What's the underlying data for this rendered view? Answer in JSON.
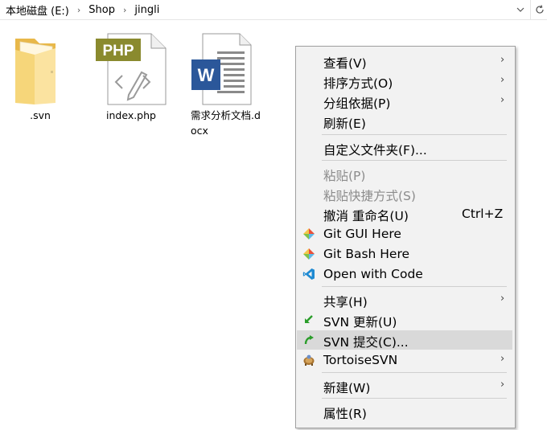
{
  "address_bar": {
    "crumbs": [
      "本地磁盘 (E:)",
      "Shop",
      "jingli"
    ],
    "separator": "›",
    "dropdown_glyph": "⌄",
    "refresh_glyph": "↻"
  },
  "files": [
    {
      "name": ".svn",
      "icon": "folder-icon"
    },
    {
      "name": "index.php",
      "icon": "php-file-icon",
      "badge": "PHP"
    },
    {
      "name": "需求分析文档.docx",
      "icon": "word-file-icon",
      "badge": "W"
    }
  ],
  "context_menu": {
    "items": [
      {
        "label": "查看(V)",
        "submenu": true
      },
      {
        "label": "排序方式(O)",
        "submenu": true
      },
      {
        "label": "分组依据(P)",
        "submenu": true
      },
      {
        "label": "刷新(E)"
      },
      {
        "label": "自定义文件夹(F)..."
      },
      {
        "label": "粘贴(P)",
        "disabled": true
      },
      {
        "label": "粘贴快捷方式(S)",
        "disabled": true
      },
      {
        "label": "撤消 重命名(U)",
        "shortcut": "Ctrl+Z"
      },
      {
        "label": "Git GUI Here",
        "icon": "git-icon"
      },
      {
        "label": "Git Bash Here",
        "icon": "git-icon"
      },
      {
        "label": "Open with Code",
        "icon": "vscode-icon"
      },
      {
        "label": "共享(H)",
        "submenu": true
      },
      {
        "label": "SVN 更新(U)",
        "icon": "svn-update-icon"
      },
      {
        "label": "SVN 提交(C)...",
        "icon": "svn-commit-icon",
        "highlighted": true
      },
      {
        "label": "TortoiseSVN",
        "icon": "tortoisesvn-icon",
        "submenu": true
      },
      {
        "label": "新建(W)",
        "submenu": true
      },
      {
        "label": "属性(R)"
      }
    ],
    "submenu_glyph": "›"
  },
  "colors": {
    "menu_bg": "#f2f2f2",
    "menu_highlight": "#d9d9d9",
    "php_badge": "#8a8a2e",
    "word_blue": "#2b579a",
    "folder_yellow": "#f6d67a"
  }
}
